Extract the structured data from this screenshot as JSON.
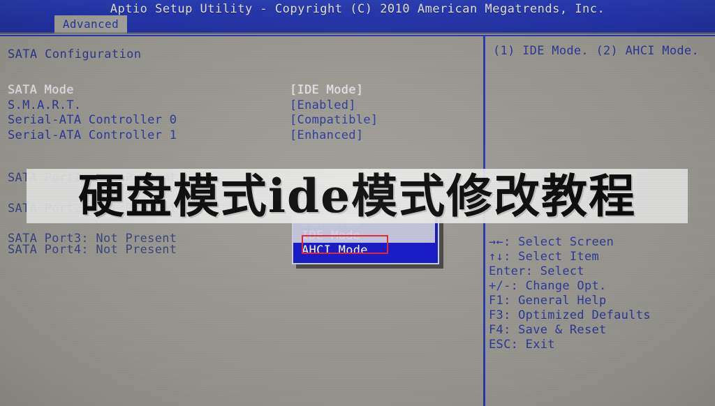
{
  "header": {
    "title": "Aptio Setup Utility - Copyright (C) 2010 American Megatrends, Inc.",
    "active_tab": "Advanced"
  },
  "colors": {
    "banner_blue": "#2b3bb4",
    "text_blue": "#2b3a9a",
    "highlight_white": "#eceaf0",
    "popup_blue": "#1414c8",
    "annotation_red": "#e8202a",
    "screen_grey": "#9d9b94"
  },
  "main": {
    "section_title": "SATA Configuration",
    "settings": [
      {
        "label": "SATA Mode",
        "value": "[IDE Mode]",
        "selected": true
      },
      {
        "label": "S.M.A.R.T.",
        "value": "[Enabled]",
        "selected": false
      },
      {
        "label": "Serial-ATA Controller 0",
        "value": "[Compatible]",
        "selected": false
      },
      {
        "label": "Serial-ATA Controller 1",
        "value": "[Enhanced]",
        "selected": false
      }
    ],
    "ports": [
      {
        "text": "SATA Port1: Not Present"
      },
      {
        "text": "SATA Port2: Not Present"
      },
      {
        "text": "SATA Port3: Not Present"
      },
      {
        "text": "SATA Port4: Not Present"
      }
    ]
  },
  "dropdown": {
    "options": [
      {
        "label": "Disabled",
        "highlighted": false
      },
      {
        "label": "IDE Mode",
        "highlighted": false
      },
      {
        "label": "AHCI Mode",
        "highlighted": true
      }
    ]
  },
  "help": {
    "description": "(1) IDE Mode. (2) AHCI Mode.",
    "keys": [
      {
        "key": "→←",
        "action": ": Select Screen"
      },
      {
        "key": "↑↓",
        "action": ": Select Item"
      },
      {
        "key": "Enter",
        "action": ": Select"
      },
      {
        "key": "+/-",
        "action": ": Change Opt."
      },
      {
        "key": "F1",
        "action": ": General Help"
      },
      {
        "key": "F3",
        "action": ": Optimized Defaults"
      },
      {
        "key": "F4",
        "action": ": Save & Reset"
      },
      {
        "key": "ESC",
        "action": ": Exit"
      }
    ]
  },
  "overlay": {
    "text": "硬盘模式ide模式修改教程"
  }
}
